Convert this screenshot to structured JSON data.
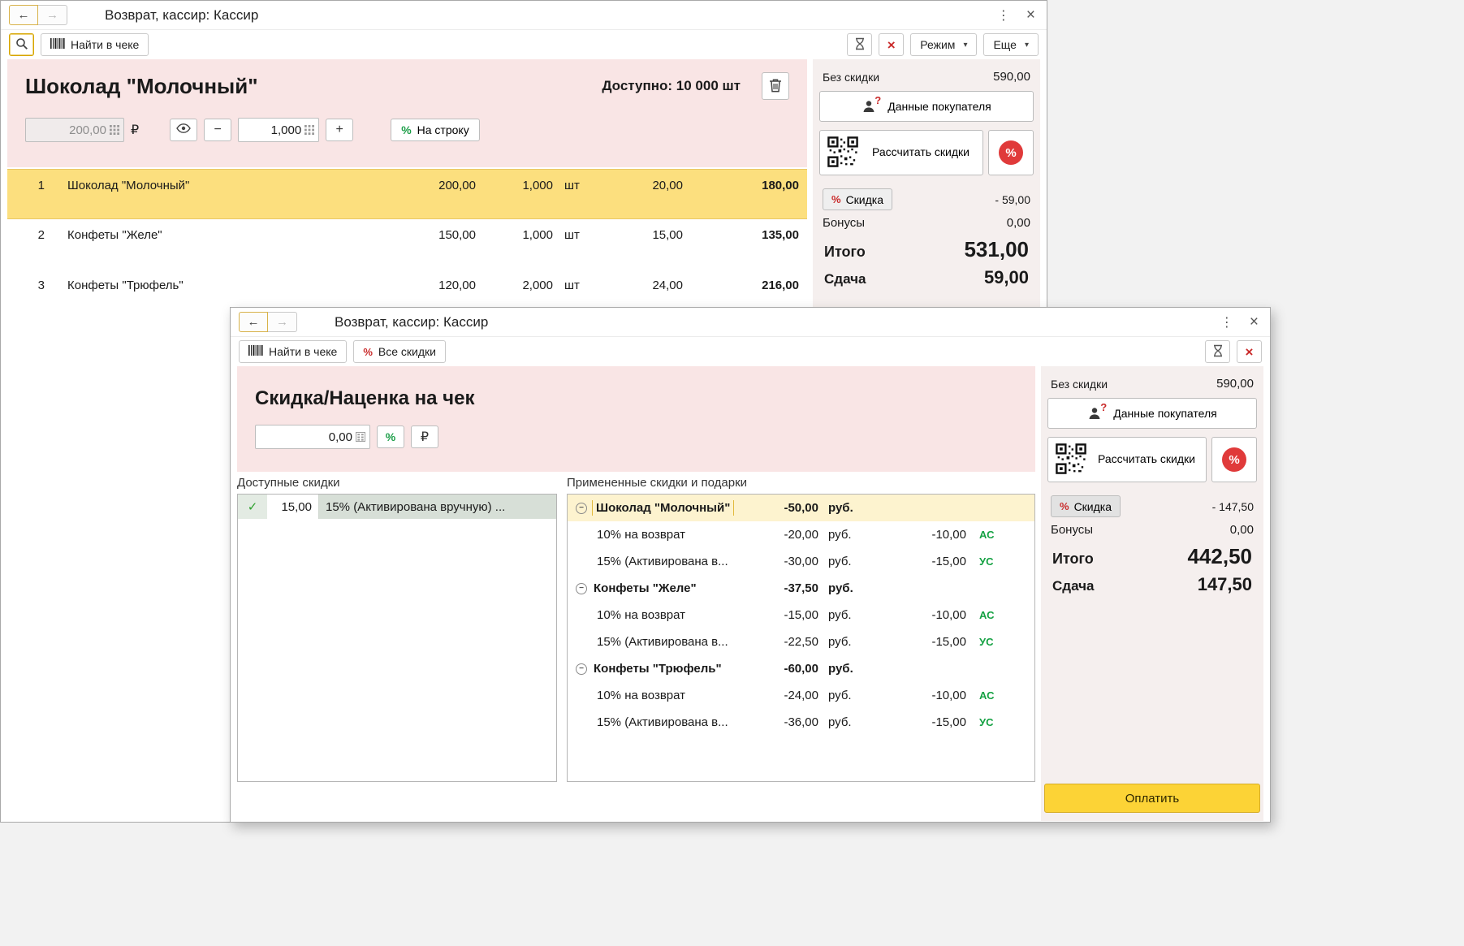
{
  "icons": {
    "back": "←",
    "forward": "→",
    "kebab": "⋮",
    "close": "×",
    "cancel": "×",
    "dropdown": "▾",
    "minus": "−",
    "plus": "+",
    "check": "✓",
    "question": "?",
    "percent": "%"
  },
  "window1": {
    "title": "Возврат, кассир: Кассир",
    "toolbar": {
      "find": "Найти в чеке",
      "mode": "Режим",
      "more": "Еще"
    },
    "product": {
      "name": "Шоколад \"Молочный\"",
      "available": "Доступно: 10 000 шт",
      "price": "200,00",
      "currency": "₽",
      "qty": "1,000",
      "percent": "%",
      "line_button": "На строку"
    },
    "rows": [
      {
        "num": "1",
        "name": "Шоколад \"Молочный\"",
        "price": "200,00",
        "qty": "1,000",
        "unit": "шт",
        "discount": "20,00",
        "total": "180,00"
      },
      {
        "num": "2",
        "name": "Конфеты \"Желе\"",
        "price": "150,00",
        "qty": "1,000",
        "unit": "шт",
        "discount": "15,00",
        "total": "135,00"
      },
      {
        "num": "3",
        "name": "Конфеты \"Трюфель\"",
        "price": "120,00",
        "qty": "2,000",
        "unit": "шт",
        "discount": "24,00",
        "total": "216,00"
      }
    ],
    "summary": {
      "no_discount_label": "Без скидки",
      "no_discount_value": "590,00",
      "customer_button": "Данные покупателя",
      "calc_button": "Рассчитать скидки",
      "percent": "%",
      "discount_button": "Скидка",
      "discount_value": "- 59,00",
      "bonus_label": "Бонусы",
      "bonus_value": "0,00",
      "total_label": "Итого",
      "total_value": "531,00",
      "change_label": "Сдача",
      "change_value": "59,00"
    }
  },
  "window2": {
    "title": "Возврат, кассир: Кассир",
    "toolbar": {
      "find": "Найти в чеке",
      "all_discounts": "Все скидки"
    },
    "header": {
      "title": "Скидка/Наценка на чек",
      "amount": "0,00",
      "percent": "%",
      "currency": "₽"
    },
    "available": {
      "header": "Доступные скидки",
      "rows": [
        {
          "value": "15,00",
          "name": "15% (Активирована вручную) ..."
        }
      ]
    },
    "applied": {
      "header": "Примененные скидки и подарки",
      "rows": [
        {
          "name": "Шоколад \"Молочный\"",
          "amount": "-50,00",
          "unit": "руб.",
          "pct": "",
          "badge": ""
        },
        {
          "name": "10% на возврат",
          "amount": "-20,00",
          "unit": "руб.",
          "pct": "-10,00",
          "badge": "АС"
        },
        {
          "name": "15% (Активирована в...",
          "amount": "-30,00",
          "unit": "руб.",
          "pct": "-15,00",
          "badge": "УС"
        },
        {
          "name": "Конфеты \"Желе\"",
          "amount": "-37,50",
          "unit": "руб.",
          "pct": "",
          "badge": ""
        },
        {
          "name": "10% на возврат",
          "amount": "-15,00",
          "unit": "руб.",
          "pct": "-10,00",
          "badge": "АС"
        },
        {
          "name": "15% (Активирована в...",
          "amount": "-22,50",
          "unit": "руб.",
          "pct": "-15,00",
          "badge": "УС"
        },
        {
          "name": "Конфеты \"Трюфель\"",
          "amount": "-60,00",
          "unit": "руб.",
          "pct": "",
          "badge": ""
        },
        {
          "name": "10% на возврат",
          "amount": "-24,00",
          "unit": "руб.",
          "pct": "-10,00",
          "badge": "АС"
        },
        {
          "name": "15% (Активирована в...",
          "amount": "-36,00",
          "unit": "руб.",
          "pct": "-15,00",
          "badge": "УС"
        }
      ]
    },
    "summary": {
      "no_discount_label": "Без скидки",
      "no_discount_value": "590,00",
      "customer_button": "Данные покупателя",
      "calc_button": "Рассчитать скидки",
      "percent": "%",
      "discount_button": "Скидка",
      "discount_value": "- 147,50",
      "bonus_label": "Бонусы",
      "bonus_value": "0,00",
      "total_label": "Итого",
      "total_value": "442,50",
      "change_label": "Сдача",
      "change_value": "147,50"
    },
    "pay_button": "Оплатить"
  }
}
